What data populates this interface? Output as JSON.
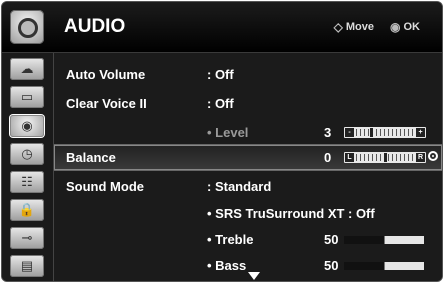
{
  "header": {
    "title": "AUDIO",
    "move_symbol": "◇",
    "move_label": "Move",
    "ok_symbol": "◉",
    "ok_label": "OK"
  },
  "sidebar": {
    "items": [
      {
        "icon": "picture-icon",
        "glyph": "☁"
      },
      {
        "icon": "screen-icon",
        "glyph": "▭"
      },
      {
        "icon": "audio-icon",
        "glyph": "◉",
        "active": true
      },
      {
        "icon": "time-icon",
        "glyph": "◷"
      },
      {
        "icon": "option-icon",
        "glyph": "☷"
      },
      {
        "icon": "lock-icon",
        "glyph": "🔒"
      },
      {
        "icon": "input-icon",
        "glyph": "⊸"
      },
      {
        "icon": "usb-icon",
        "glyph": "▤"
      }
    ]
  },
  "menu": {
    "auto_volume": {
      "label": "Auto Volume",
      "value": ": Off"
    },
    "clear_voice": {
      "label": "Clear Voice II",
      "value": ": Off"
    },
    "level": {
      "label": "• Level",
      "value": "3",
      "slider_minus": "-",
      "slider_plus": "+",
      "level_fraction": 0.25
    },
    "balance": {
      "label": "Balance",
      "value": "0",
      "slider_left": "L",
      "slider_right": "R",
      "balance_fraction": 0.5
    },
    "sound_mode": {
      "label": "Sound Mode",
      "value": ": Standard"
    },
    "srs": {
      "label": "• SRS TruSurround XT",
      "value": ": Off"
    },
    "treble": {
      "label": "• Treble",
      "value": "50",
      "fraction": 0.5
    },
    "bass": {
      "label": "• Bass",
      "value": "50",
      "fraction": 0.5
    }
  }
}
